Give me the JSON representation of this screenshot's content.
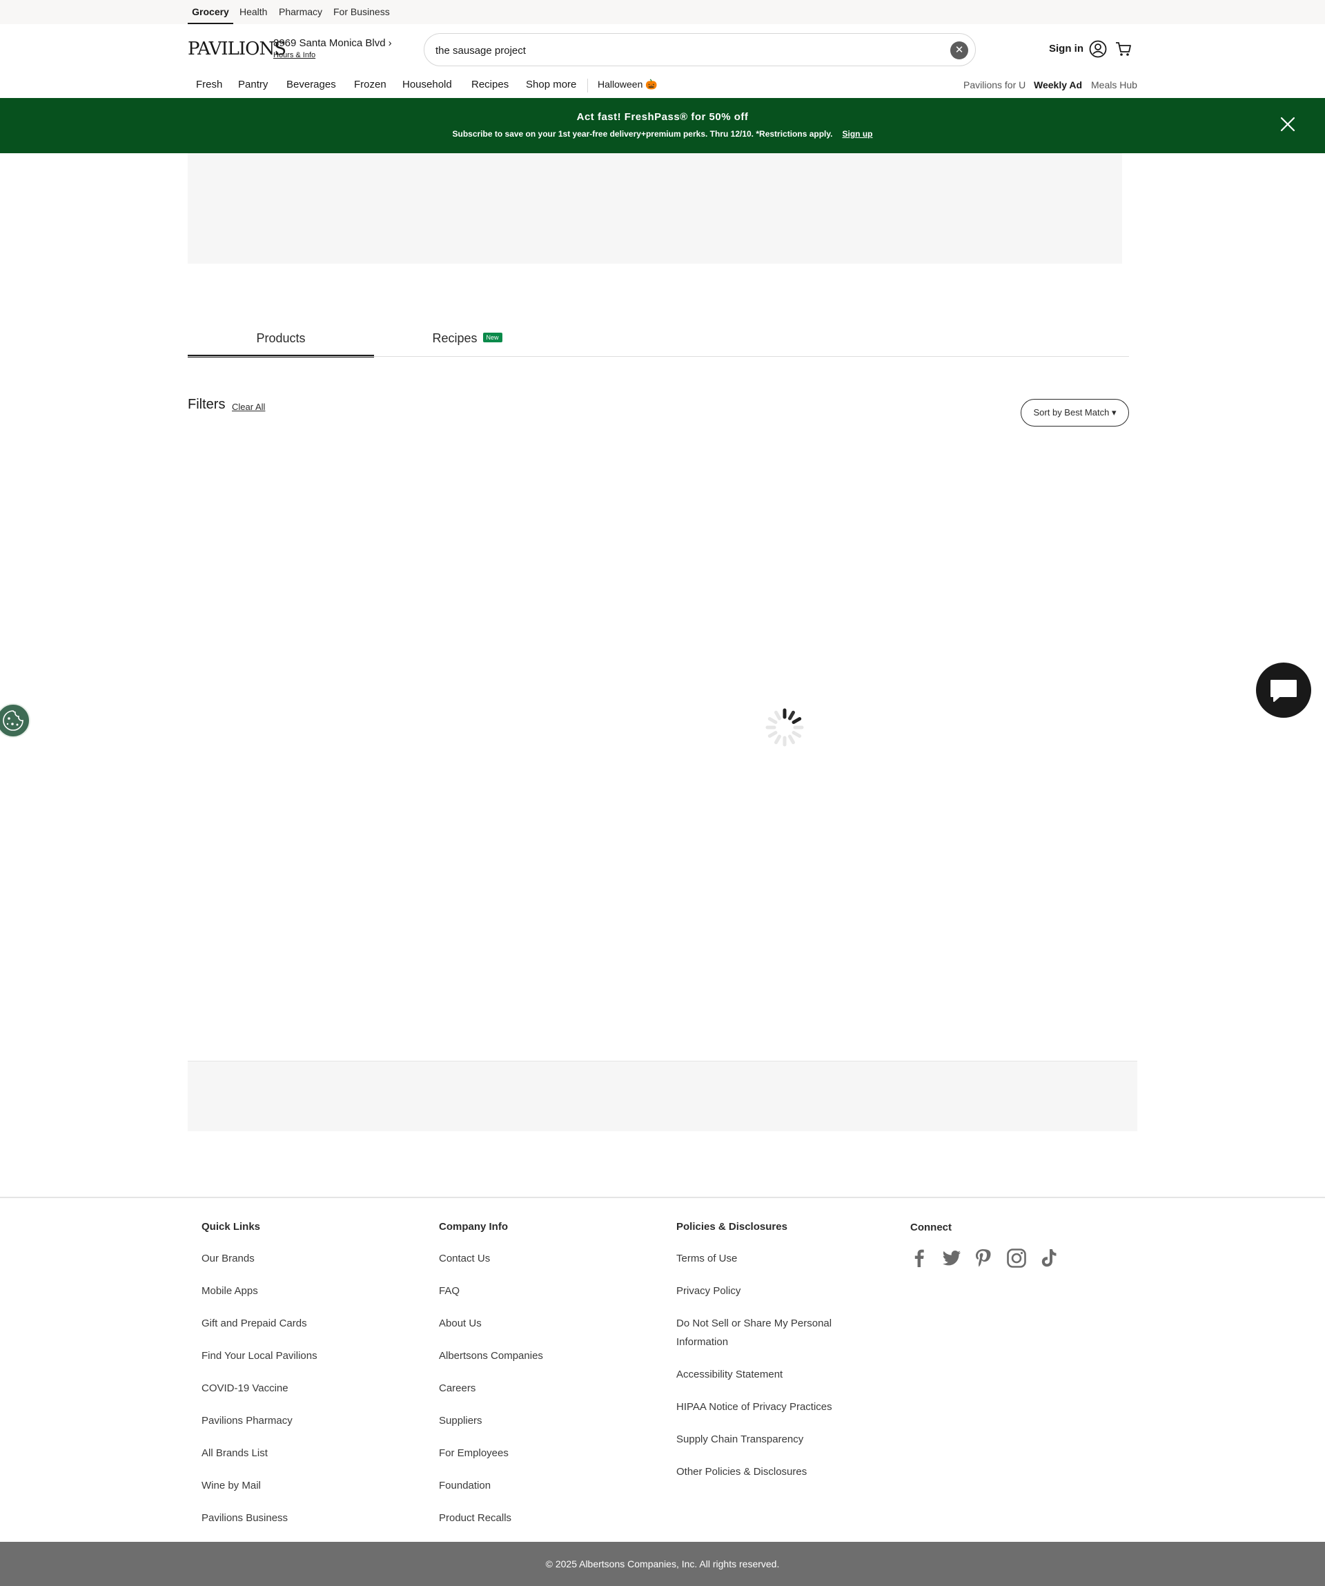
{
  "util_nav": [
    "Grocery",
    "Health",
    "Pharmacy",
    "For Business"
  ],
  "header": {
    "logo": "PAVILIONS",
    "store_address": "8969 Santa Monica Blvd",
    "store_hours": "Hours & Info",
    "search_value": "the sausage project",
    "sign_in": "Sign in"
  },
  "main_nav": [
    "Fresh",
    "Pantry",
    "Beverages",
    "Frozen",
    "Household",
    "Recipes",
    "Shop more"
  ],
  "seasonal": "Halloween 🎃",
  "nav_right": [
    "Pavilions for U",
    "Weekly Ad",
    "Meals Hub"
  ],
  "promo": {
    "title": "Act fast! FreshPass® for 50% off",
    "subtitle": "Subscribe to save on your 1st year-free delivery+premium perks. Thru 12/10. *Restrictions apply.",
    "cta": "Sign up"
  },
  "tabs": {
    "products": "Products",
    "recipes": "Recipes",
    "recipes_badge": "New"
  },
  "filters": {
    "label": "Filters",
    "clear_all": "Clear All",
    "sort": "Sort by Best Match ▾"
  },
  "footer": {
    "quick_links": {
      "title": "Quick Links",
      "links": [
        "Our Brands",
        "Mobile Apps",
        "Gift and Prepaid Cards",
        "Find Your Local Pavilions",
        "COVID-19 Vaccine",
        "Pavilions Pharmacy",
        "All Brands List",
        "Wine by Mail",
        "Pavilions Business"
      ]
    },
    "company_info": {
      "title": "Company Info",
      "links": [
        "Contact Us",
        "FAQ",
        "About Us",
        "Albertsons Companies",
        "Careers",
        "Suppliers",
        "For Employees",
        "Foundation",
        "Product Recalls"
      ]
    },
    "policies": {
      "title": "Policies & Disclosures",
      "links": [
        "Terms of Use",
        "Privacy Policy",
        "Do Not Sell or Share My Personal Information",
        "Accessibility Statement",
        "HIPAA Notice of Privacy Practices",
        "Supply Chain Transparency",
        "Other Policies & Disclosures"
      ]
    },
    "connect": {
      "title": "Connect",
      "icons": [
        "facebook-icon",
        "twitter-icon",
        "pinterest-icon",
        "instagram-icon",
        "tiktok-icon"
      ]
    },
    "copyright": "© 2025 Albertsons Companies, Inc.  All rights reserved."
  },
  "colors": {
    "promo_bg": "#07511e",
    "badge_new": "#0b8a4a",
    "footer_bottom": "#6e6e6e"
  }
}
